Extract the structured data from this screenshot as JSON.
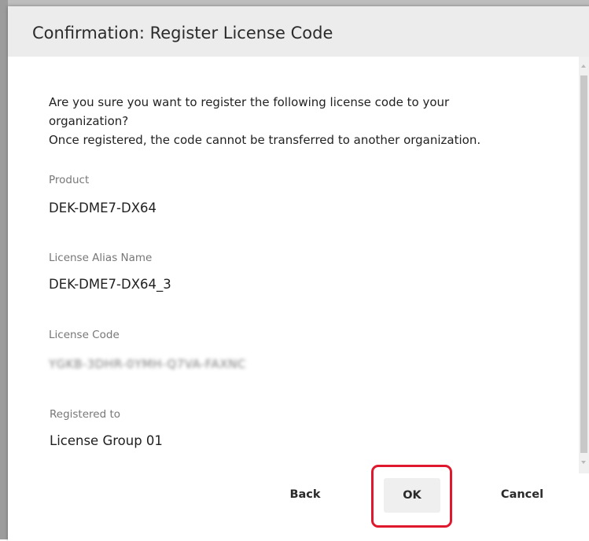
{
  "dialog": {
    "title": "Confirmation: Register License Code",
    "message_lines": [
      "Are you sure you want to register the following license code to your",
      "organization?",
      "Once registered, the code cannot be transferred to another organization."
    ]
  },
  "fields": {
    "product": {
      "label": "Product",
      "value": "DEK-DME7-DX64"
    },
    "alias": {
      "label": "License Alias Name",
      "value": "DEK-DME7-DX64_3"
    },
    "code": {
      "label": "License Code",
      "value": "YGKB-3DHR-0YMH-Q7VA-FAXNC"
    },
    "registered": {
      "label": "Registered to",
      "value": "License Group 01"
    }
  },
  "buttons": {
    "back": "Back",
    "ok": "OK",
    "cancel": "Cancel"
  },
  "colors": {
    "highlight": "#e0182d",
    "header_bg": "#ececec",
    "ok_bg": "#efefef"
  }
}
